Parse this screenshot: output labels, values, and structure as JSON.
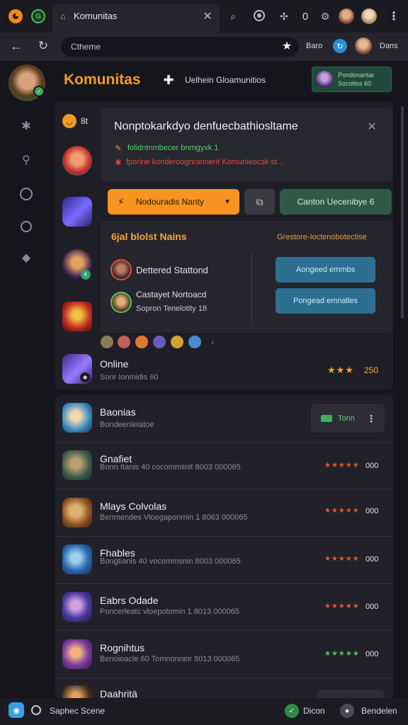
{
  "browser": {
    "tab_title": "Komunitas",
    "address": "Ctheme",
    "bookmark_label": "Baro",
    "profile_label": "Dans"
  },
  "header": {
    "brand": "Komunitas",
    "link": "Uelhein Gloamunitios",
    "profile_chip_line1": "Pondonantar",
    "profile_chip_line2": "Socotlos 60"
  },
  "card": {
    "title": "Nonptokarkdyo denfuecbathiosltame",
    "line1": "folidntnmbecer bnmgyxk 1",
    "line2": "fporine konderoognrannent Komunieocsk st..."
  },
  "actions": {
    "primary_label": "Nodouradis Nanty",
    "secondary_label": "Canton Uecenibye 6"
  },
  "section": {
    "title": "6jal blolst Nains",
    "link": "Grestore-Ioctenobotectise",
    "items": [
      {
        "label": "Dettered Stattond"
      },
      {
        "label": "Castayet Nortoacd",
        "sub": "Sopron Tenelotity 18"
      }
    ],
    "button1": "Aongeed emmbs",
    "button2": "Pongead emnalles"
  },
  "online": {
    "title": "Online",
    "sub": "Sonr Ionmidis 60",
    "rating": "★★★",
    "value": "250"
  },
  "list": {
    "top": {
      "title": "Baonias",
      "sub": "Bondeenleiatoe",
      "button": "Tonn"
    },
    "rows": [
      {
        "title": "Gnafiet",
        "sub": "Bonn Itanis   40 cocommiinit 8003 000065",
        "stars": "★★★★★",
        "value": "000"
      },
      {
        "title": "Mlays Colvolas",
        "sub": "Benmendes Vloegaponmin 1 8063 000065",
        "stars": "★★★★★",
        "value": "000"
      },
      {
        "title": "Fhables",
        "sub": "Bongtianis   40 vocommsnin 8003 000065",
        "stars": "★★★★★",
        "value": "000"
      },
      {
        "title": "Eabrs Odade",
        "sub": "Poncerleatc vloepotomin 1 8013 000065",
        "stars": "★★★★★",
        "value": "000"
      },
      {
        "title": "Rognihtus",
        "sub": "Benoioacle 60  Tomnonnior 8013 000065",
        "stars": "★★★★★",
        "value": "000"
      },
      {
        "title": "Daahritä",
        "sub": "",
        "stars": "",
        "value": ""
      }
    ]
  },
  "bottom": {
    "left_label": "Saphec Scene",
    "btn1": "Dicon",
    "btn2": "Bendelen"
  }
}
